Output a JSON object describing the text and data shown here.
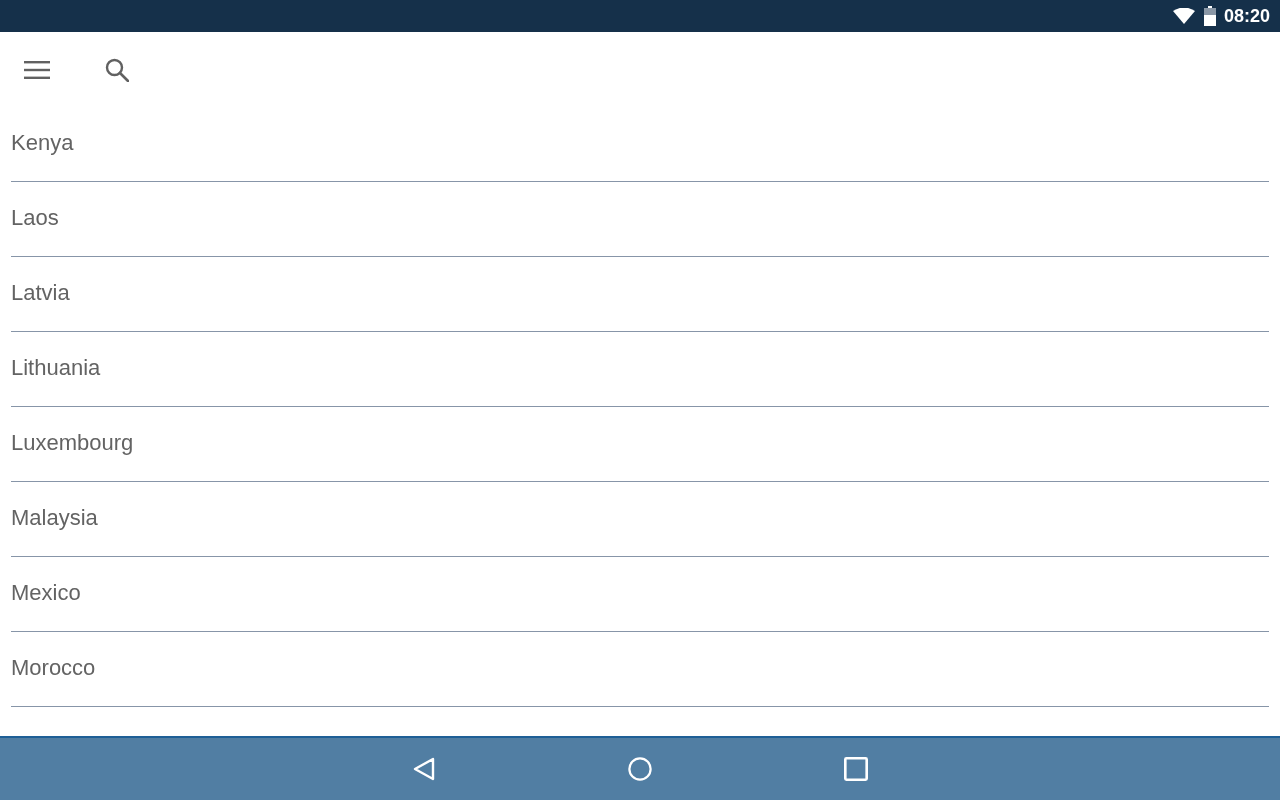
{
  "status_bar": {
    "time": "08:20"
  },
  "countries": [
    "Kenya",
    "Laos",
    "Latvia",
    "Lithuania",
    "Luxembourg",
    "Malaysia",
    "Mexico",
    "Morocco"
  ]
}
